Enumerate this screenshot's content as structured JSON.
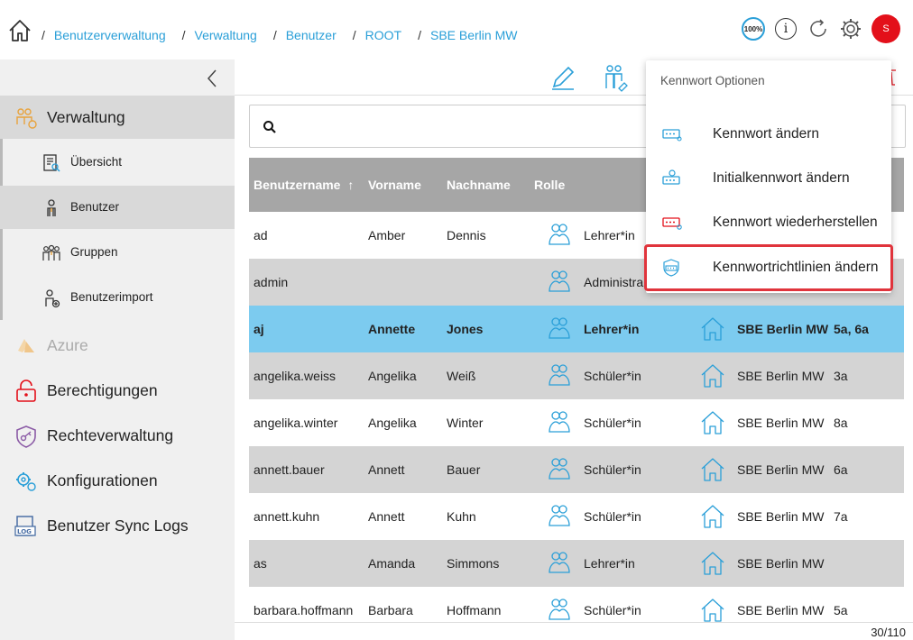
{
  "breadcrumb": {
    "separator": "/",
    "items": [
      "Benutzerverwaltung",
      "Verwaltung",
      "Benutzer",
      "ROOT",
      "SBE Berlin MW"
    ]
  },
  "header": {
    "zoom": "100%",
    "info": "i",
    "avatar_initial": "S"
  },
  "colors": {
    "accent": "#2a9fd8",
    "selected_row": "#7ccbef",
    "danger": "#e3101a",
    "header_row": "#a6a6a6"
  },
  "sidebar": {
    "main": [
      {
        "label": "Verwaltung",
        "icon": "users-admin-icon"
      },
      {
        "label": "Azure",
        "icon": "cloud-icon"
      },
      {
        "label": "Berechtigungen",
        "icon": "lock-icon"
      },
      {
        "label": "Rechteverwaltung",
        "icon": "shield-key-icon"
      },
      {
        "label": "Konfigurationen",
        "icon": "gears-icon"
      },
      {
        "label": "Benutzer Sync Logs",
        "icon": "log-icon"
      }
    ],
    "sub": [
      {
        "label": "Übersicht",
        "icon": "overview-icon"
      },
      {
        "label": "Benutzer",
        "icon": "user-icon"
      },
      {
        "label": "Gruppen",
        "icon": "group-icon"
      },
      {
        "label": "Benutzerimport",
        "icon": "user-import-icon"
      }
    ]
  },
  "table": {
    "columns": [
      "Benutzername",
      "Vorname",
      "Nachname",
      "Rolle"
    ],
    "sort_indicator": "↑",
    "rows": [
      {
        "user": "ad",
        "first": "Amber",
        "last": "Dennis",
        "role": "Lehrer*in",
        "school": "",
        "classes": ""
      },
      {
        "user": "admin",
        "first": "",
        "last": "",
        "role": "Administra",
        "school": "",
        "classes": ""
      },
      {
        "user": "aj",
        "first": "Annette",
        "last": "Jones",
        "role": "Lehrer*in",
        "school": "SBE Berlin MW",
        "classes": "5a, 6a"
      },
      {
        "user": "angelika.weiss",
        "first": "Angelika",
        "last": "Weiß",
        "role": "Schüler*in",
        "school": "SBE Berlin MW",
        "classes": "3a"
      },
      {
        "user": "angelika.winter",
        "first": "Angelika",
        "last": "Winter",
        "role": "Schüler*in",
        "school": "SBE Berlin MW",
        "classes": "8a"
      },
      {
        "user": "annett.bauer",
        "first": "Annett",
        "last": "Bauer",
        "role": "Schüler*in",
        "school": "SBE Berlin MW",
        "classes": "6a"
      },
      {
        "user": "annett.kuhn",
        "first": "Annett",
        "last": "Kuhn",
        "role": "Schüler*in",
        "school": "SBE Berlin MW",
        "classes": "7a"
      },
      {
        "user": "as",
        "first": "Amanda",
        "last": "Simmons",
        "role": "Lehrer*in",
        "school": "SBE Berlin MW",
        "classes": ""
      },
      {
        "user": "barbara.hoffmann",
        "first": "Barbara",
        "last": "Hoffmann",
        "role": "Schüler*in",
        "school": "SBE Berlin MW",
        "classes": "5a"
      }
    ],
    "count": "30/110"
  },
  "dropdown": {
    "title": "Kennwort Optionen",
    "items": [
      {
        "label": "Kennwort ändern",
        "icon": "password-change-icon"
      },
      {
        "label": "Initialkennwort ändern",
        "icon": "initial-password-icon"
      },
      {
        "label": "Kennwort wiederherstellen",
        "icon": "password-restore-icon"
      },
      {
        "label": "Kennwortrichtlinien ändern",
        "icon": "password-policy-icon"
      }
    ]
  }
}
